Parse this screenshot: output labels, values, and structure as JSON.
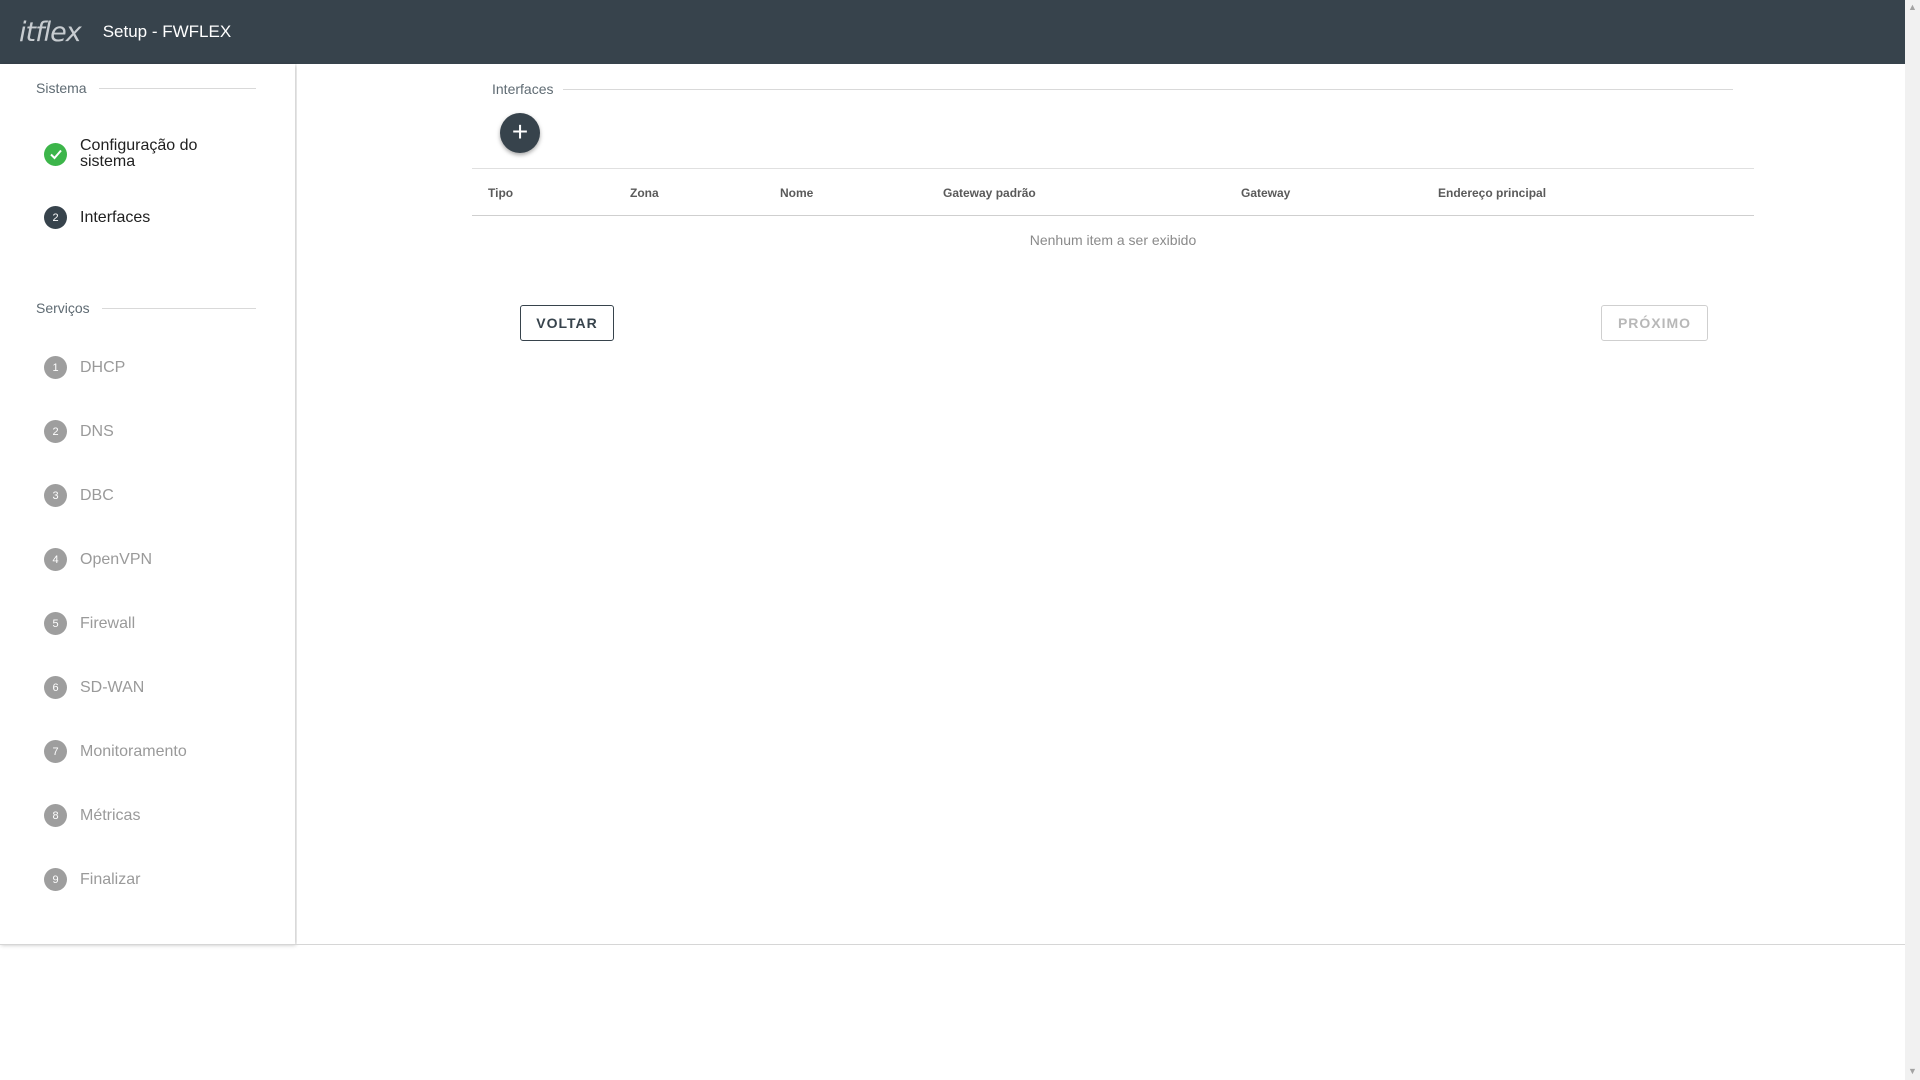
{
  "header": {
    "logo": "itflex",
    "title": "Setup - FWFLEX"
  },
  "sidebar": {
    "system_section": "Sistema",
    "system_steps": [
      {
        "badge": "✓",
        "label": "Configuração do sistema",
        "state": "done"
      },
      {
        "badge": "2",
        "label": "Interfaces",
        "state": "active"
      }
    ],
    "services_section": "Serviços",
    "service_steps": [
      {
        "badge": "1",
        "label": "DHCP"
      },
      {
        "badge": "2",
        "label": "DNS"
      },
      {
        "badge": "3",
        "label": "DBC"
      },
      {
        "badge": "4",
        "label": "OpenVPN"
      },
      {
        "badge": "5",
        "label": "Firewall"
      },
      {
        "badge": "6",
        "label": "SD-WAN"
      },
      {
        "badge": "7",
        "label": "Monitoramento"
      },
      {
        "badge": "8",
        "label": "Métricas"
      },
      {
        "badge": "9",
        "label": "Finalizar"
      }
    ]
  },
  "main": {
    "section_title": "Interfaces",
    "add_button": "+",
    "table": {
      "columns": [
        "Tipo",
        "Zona",
        "Nome",
        "Gateway padrão",
        "Gateway",
        "Endereço principal"
      ],
      "empty_text": "Nenhum item a ser exibido"
    },
    "back_label": "VOLTAR",
    "next_label": "PRÓXIMO"
  },
  "colors": {
    "topbar": "#37434c",
    "done": "#3cb54a",
    "active": "#37434c",
    "idle": "#9e9e9e"
  }
}
